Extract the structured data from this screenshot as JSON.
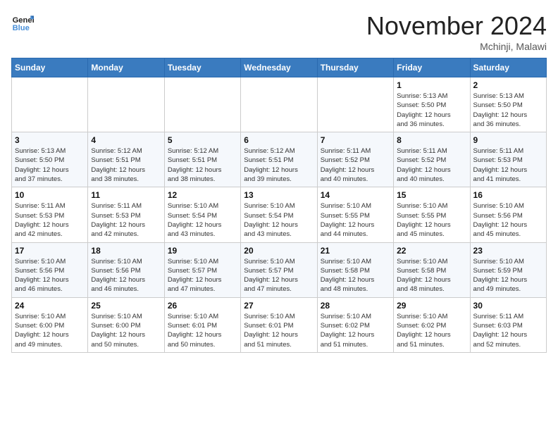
{
  "header": {
    "logo_line1": "General",
    "logo_line2": "Blue",
    "month_title": "November 2024",
    "location": "Mchinji, Malawi"
  },
  "weekdays": [
    "Sunday",
    "Monday",
    "Tuesday",
    "Wednesday",
    "Thursday",
    "Friday",
    "Saturday"
  ],
  "weeks": [
    [
      {
        "day": "",
        "info": ""
      },
      {
        "day": "",
        "info": ""
      },
      {
        "day": "",
        "info": ""
      },
      {
        "day": "",
        "info": ""
      },
      {
        "day": "",
        "info": ""
      },
      {
        "day": "1",
        "info": "Sunrise: 5:13 AM\nSunset: 5:50 PM\nDaylight: 12 hours\nand 36 minutes."
      },
      {
        "day": "2",
        "info": "Sunrise: 5:13 AM\nSunset: 5:50 PM\nDaylight: 12 hours\nand 36 minutes."
      }
    ],
    [
      {
        "day": "3",
        "info": "Sunrise: 5:13 AM\nSunset: 5:50 PM\nDaylight: 12 hours\nand 37 minutes."
      },
      {
        "day": "4",
        "info": "Sunrise: 5:12 AM\nSunset: 5:51 PM\nDaylight: 12 hours\nand 38 minutes."
      },
      {
        "day": "5",
        "info": "Sunrise: 5:12 AM\nSunset: 5:51 PM\nDaylight: 12 hours\nand 38 minutes."
      },
      {
        "day": "6",
        "info": "Sunrise: 5:12 AM\nSunset: 5:51 PM\nDaylight: 12 hours\nand 39 minutes."
      },
      {
        "day": "7",
        "info": "Sunrise: 5:11 AM\nSunset: 5:52 PM\nDaylight: 12 hours\nand 40 minutes."
      },
      {
        "day": "8",
        "info": "Sunrise: 5:11 AM\nSunset: 5:52 PM\nDaylight: 12 hours\nand 40 minutes."
      },
      {
        "day": "9",
        "info": "Sunrise: 5:11 AM\nSunset: 5:53 PM\nDaylight: 12 hours\nand 41 minutes."
      }
    ],
    [
      {
        "day": "10",
        "info": "Sunrise: 5:11 AM\nSunset: 5:53 PM\nDaylight: 12 hours\nand 42 minutes."
      },
      {
        "day": "11",
        "info": "Sunrise: 5:11 AM\nSunset: 5:53 PM\nDaylight: 12 hours\nand 42 minutes."
      },
      {
        "day": "12",
        "info": "Sunrise: 5:10 AM\nSunset: 5:54 PM\nDaylight: 12 hours\nand 43 minutes."
      },
      {
        "day": "13",
        "info": "Sunrise: 5:10 AM\nSunset: 5:54 PM\nDaylight: 12 hours\nand 43 minutes."
      },
      {
        "day": "14",
        "info": "Sunrise: 5:10 AM\nSunset: 5:55 PM\nDaylight: 12 hours\nand 44 minutes."
      },
      {
        "day": "15",
        "info": "Sunrise: 5:10 AM\nSunset: 5:55 PM\nDaylight: 12 hours\nand 45 minutes."
      },
      {
        "day": "16",
        "info": "Sunrise: 5:10 AM\nSunset: 5:56 PM\nDaylight: 12 hours\nand 45 minutes."
      }
    ],
    [
      {
        "day": "17",
        "info": "Sunrise: 5:10 AM\nSunset: 5:56 PM\nDaylight: 12 hours\nand 46 minutes."
      },
      {
        "day": "18",
        "info": "Sunrise: 5:10 AM\nSunset: 5:56 PM\nDaylight: 12 hours\nand 46 minutes."
      },
      {
        "day": "19",
        "info": "Sunrise: 5:10 AM\nSunset: 5:57 PM\nDaylight: 12 hours\nand 47 minutes."
      },
      {
        "day": "20",
        "info": "Sunrise: 5:10 AM\nSunset: 5:57 PM\nDaylight: 12 hours\nand 47 minutes."
      },
      {
        "day": "21",
        "info": "Sunrise: 5:10 AM\nSunset: 5:58 PM\nDaylight: 12 hours\nand 48 minutes."
      },
      {
        "day": "22",
        "info": "Sunrise: 5:10 AM\nSunset: 5:58 PM\nDaylight: 12 hours\nand 48 minutes."
      },
      {
        "day": "23",
        "info": "Sunrise: 5:10 AM\nSunset: 5:59 PM\nDaylight: 12 hours\nand 49 minutes."
      }
    ],
    [
      {
        "day": "24",
        "info": "Sunrise: 5:10 AM\nSunset: 6:00 PM\nDaylight: 12 hours\nand 49 minutes."
      },
      {
        "day": "25",
        "info": "Sunrise: 5:10 AM\nSunset: 6:00 PM\nDaylight: 12 hours\nand 50 minutes."
      },
      {
        "day": "26",
        "info": "Sunrise: 5:10 AM\nSunset: 6:01 PM\nDaylight: 12 hours\nand 50 minutes."
      },
      {
        "day": "27",
        "info": "Sunrise: 5:10 AM\nSunset: 6:01 PM\nDaylight: 12 hours\nand 51 minutes."
      },
      {
        "day": "28",
        "info": "Sunrise: 5:10 AM\nSunset: 6:02 PM\nDaylight: 12 hours\nand 51 minutes."
      },
      {
        "day": "29",
        "info": "Sunrise: 5:10 AM\nSunset: 6:02 PM\nDaylight: 12 hours\nand 51 minutes."
      },
      {
        "day": "30",
        "info": "Sunrise: 5:11 AM\nSunset: 6:03 PM\nDaylight: 12 hours\nand 52 minutes."
      }
    ]
  ]
}
